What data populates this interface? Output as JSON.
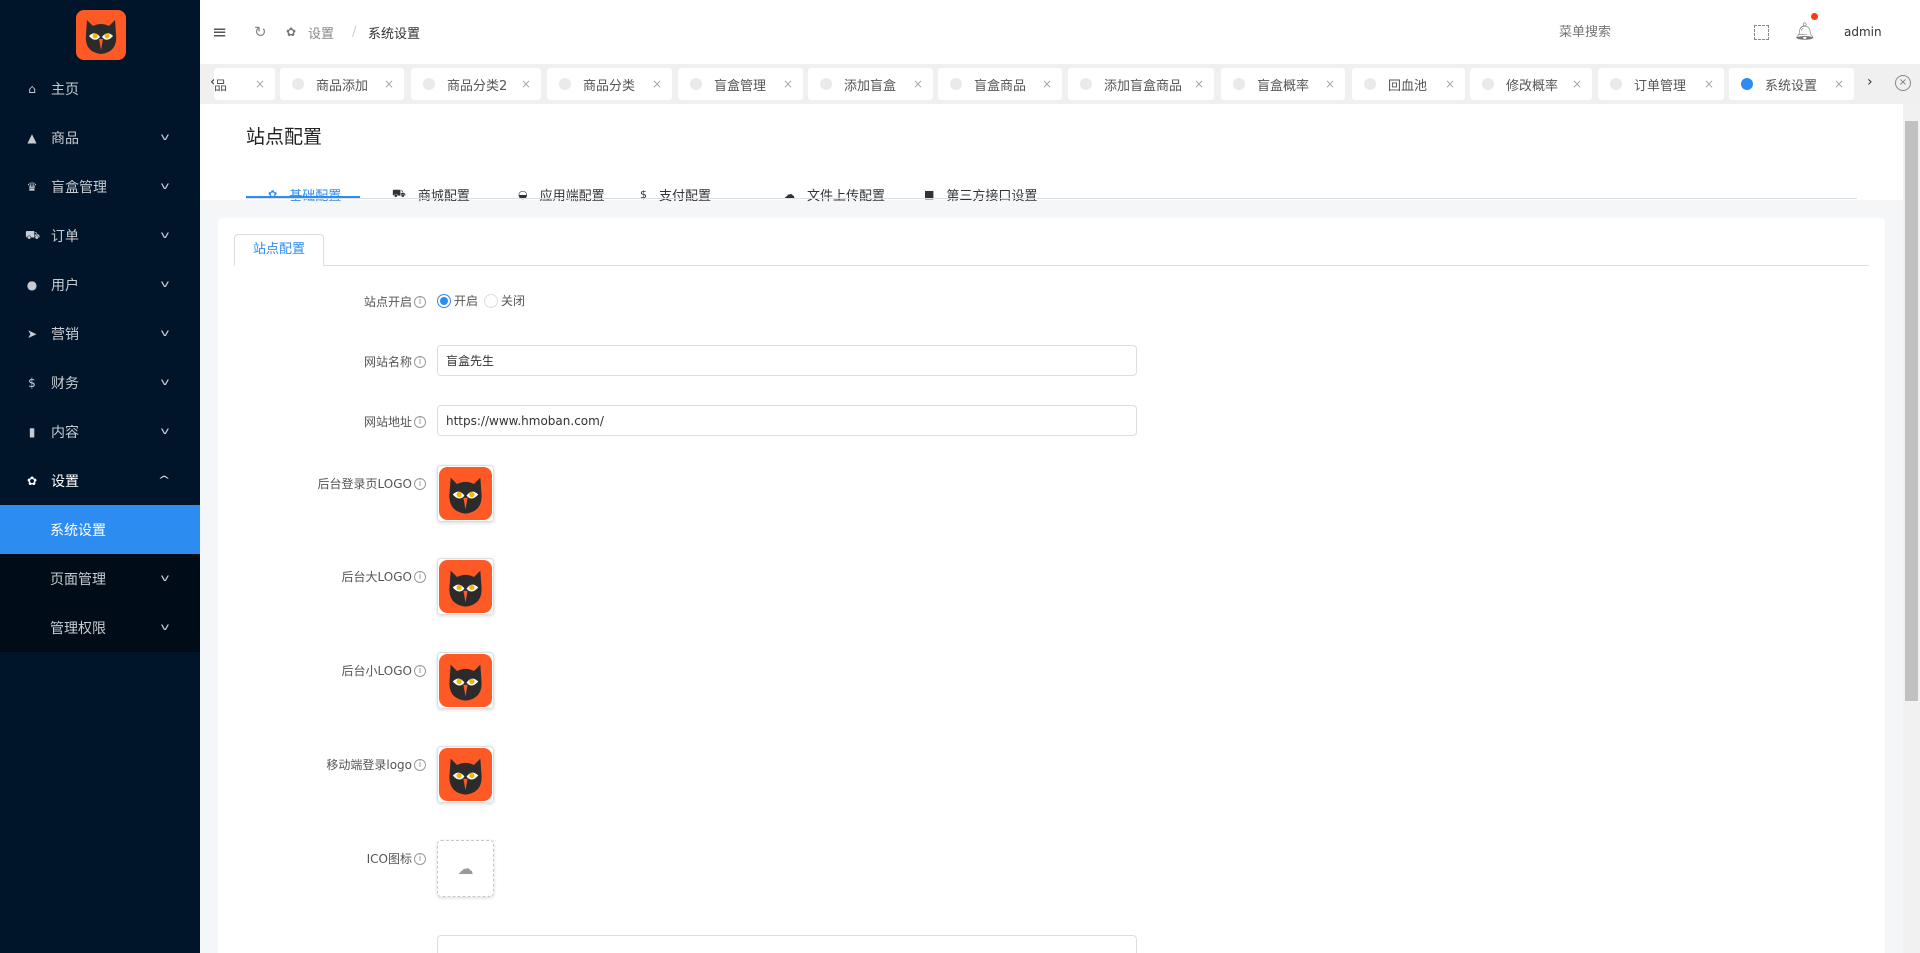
{
  "sidebar": {
    "items": [
      {
        "label": "主页",
        "icon": "home-icon",
        "glyph": "⌂"
      },
      {
        "label": "商品",
        "icon": "basket-icon",
        "glyph": "▲"
      },
      {
        "label": "盲盒管理",
        "icon": "trophy-icon",
        "glyph": "♛"
      },
      {
        "label": "订单",
        "icon": "cart-icon",
        "glyph": "⛟"
      },
      {
        "label": "用户",
        "icon": "user-icon",
        "glyph": "●"
      },
      {
        "label": "营销",
        "icon": "send-icon",
        "glyph": "➤"
      },
      {
        "label": "财务",
        "icon": "dollar-icon",
        "glyph": "$"
      },
      {
        "label": "内容",
        "icon": "book-icon",
        "glyph": "▮"
      },
      {
        "label": "设置",
        "icon": "gear-icon",
        "glyph": "✿"
      }
    ],
    "sub": [
      {
        "label": "系统设置"
      },
      {
        "label": "页面管理"
      },
      {
        "label": "管理权限"
      }
    ]
  },
  "header": {
    "breadcrumb_parent": "设置",
    "breadcrumb_sep": "/",
    "breadcrumb_current": "系统设置",
    "search_placeholder": "菜单搜索",
    "user": "admin"
  },
  "tabs": [
    {
      "label": "品"
    },
    {
      "label": "商品添加"
    },
    {
      "label": "商品分类2"
    },
    {
      "label": "商品分类"
    },
    {
      "label": "盲盒管理"
    },
    {
      "label": "添加盲盒"
    },
    {
      "label": "盲盒商品"
    },
    {
      "label": "添加盲盒商品"
    },
    {
      "label": "盲盒概率"
    },
    {
      "label": "回血池"
    },
    {
      "label": "修改概率"
    },
    {
      "label": "订单管理"
    },
    {
      "label": "系统设置",
      "active": true
    }
  ],
  "page": {
    "title": "站点配置",
    "subtabs": [
      {
        "label": "基础配置",
        "glyph": "✿"
      },
      {
        "label": "商城配置",
        "glyph": "⛟"
      },
      {
        "label": "应用端配置",
        "glyph": "◒"
      },
      {
        "label": "支付配置",
        "glyph": "$"
      },
      {
        "label": "文件上传配置",
        "glyph": "☁"
      },
      {
        "label": "第三方接口设置",
        "glyph": "■"
      }
    ],
    "card_tab": "站点配置",
    "form": {
      "site_open_label": "站点开启",
      "radio_on": "开启",
      "radio_off": "关闭",
      "site_name_label": "网站名称",
      "site_name": "盲盒先生",
      "site_url_label": "网站地址",
      "site_url": "https://www.hmoban.com/",
      "login_logo_label": "后台登录页LOGO",
      "big_logo_label": "后台大LOGO",
      "small_logo_label": "后台小LOGO",
      "mobile_logo_label": "移动端登录logo",
      "ico_label": "ICO图标"
    }
  },
  "colors": {
    "accent": "#2d8cf0",
    "sidebar": "#001529",
    "logo": "#ff5a26"
  }
}
